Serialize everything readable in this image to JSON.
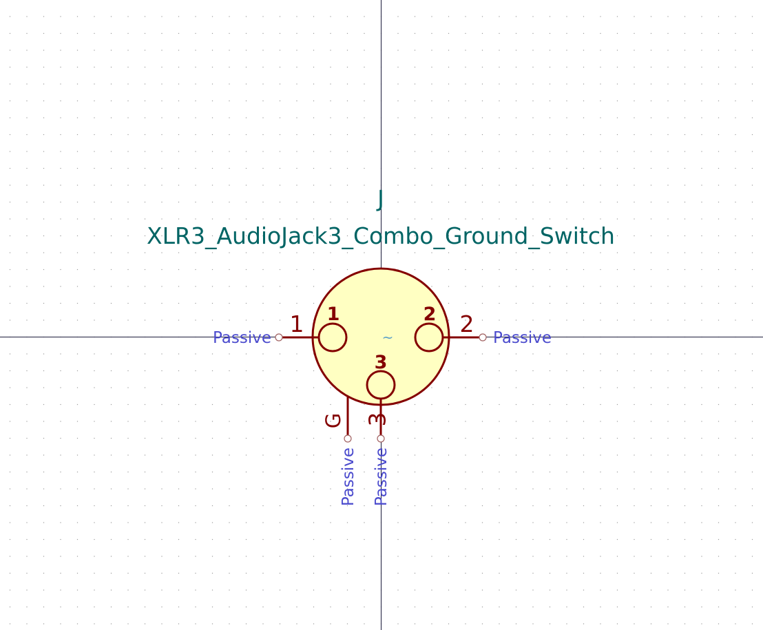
{
  "symbol": {
    "reference": "J",
    "value": "XLR3_AudioJack3_Combo_Ground_Switch",
    "unit_marker": "~"
  },
  "pins": [
    {
      "number": "1",
      "name": "1",
      "type": "Passive"
    },
    {
      "number": "2",
      "name": "2",
      "type": "Passive"
    },
    {
      "number": "3",
      "name": "3",
      "type": "Passive"
    },
    {
      "number": "G",
      "type": "Passive"
    }
  ],
  "colors": {
    "background": "#ffffff",
    "grid_dot": "#9a9a9a",
    "axis": "#1a1a3a",
    "body_fill": "#ffffc2",
    "body_stroke": "#840000",
    "pin": "#840000",
    "field_text": "#006464",
    "pin_type_text": "#4a4acd"
  }
}
